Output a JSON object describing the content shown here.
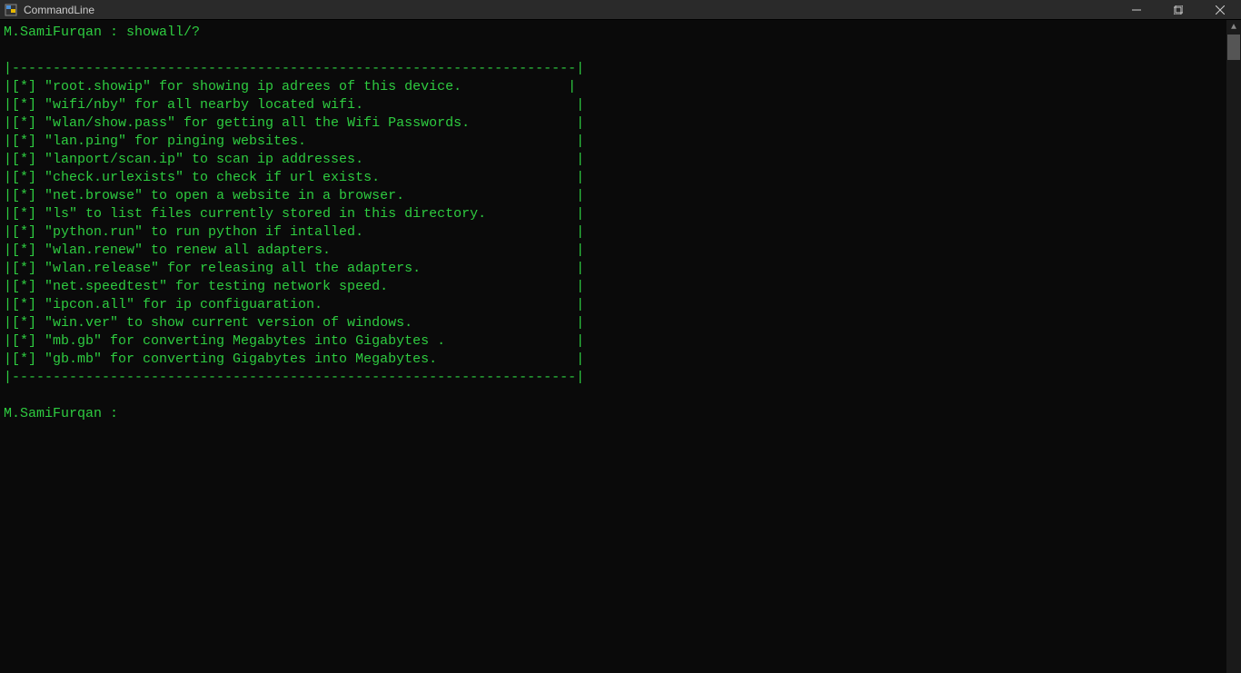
{
  "window": {
    "title": "CommandLine"
  },
  "terminal": {
    "prompt1_user": "M.SamiFurqan : ",
    "prompt1_cmd": "showall/?",
    "border": "|---------------------------------------------------------------------|",
    "rows": [
      "|[*] \"root.showip\" for showing ip adrees of this device.             |",
      "|[*] \"wifi/nby\" for all nearby located wifi.                          |",
      "|[*] \"wlan/show.pass\" for getting all the Wifi Passwords.             |",
      "|[*] \"lan.ping\" for pinging websites.                                 |",
      "|[*] \"lanport/scan.ip\" to scan ip addresses.                          |",
      "|[*] \"check.urlexists\" to check if url exists.                        |",
      "|[*] \"net.browse\" to open a website in a browser.                     |",
      "|[*] \"ls\" to list files currently stored in this directory.           |",
      "|[*] \"python.run\" to run python if intalled.                          |",
      "|[*] \"wlan.renew\" to renew all adapters.                              |",
      "|[*] \"wlan.release\" for releasing all the adapters.                   |",
      "|[*] \"net.speedtest\" for testing network speed.                       |",
      "|[*] \"ipcon.all\" for ip configuaration.                               |",
      "|[*] \"win.ver\" to show current version of windows.                    |",
      "|[*] \"mb.gb\" for converting Megabytes into Gigabytes .                |",
      "|[*] \"gb.mb\" for converting Gigabytes into Megabytes.                 |"
    ],
    "prompt2": "M.SamiFurqan : "
  }
}
